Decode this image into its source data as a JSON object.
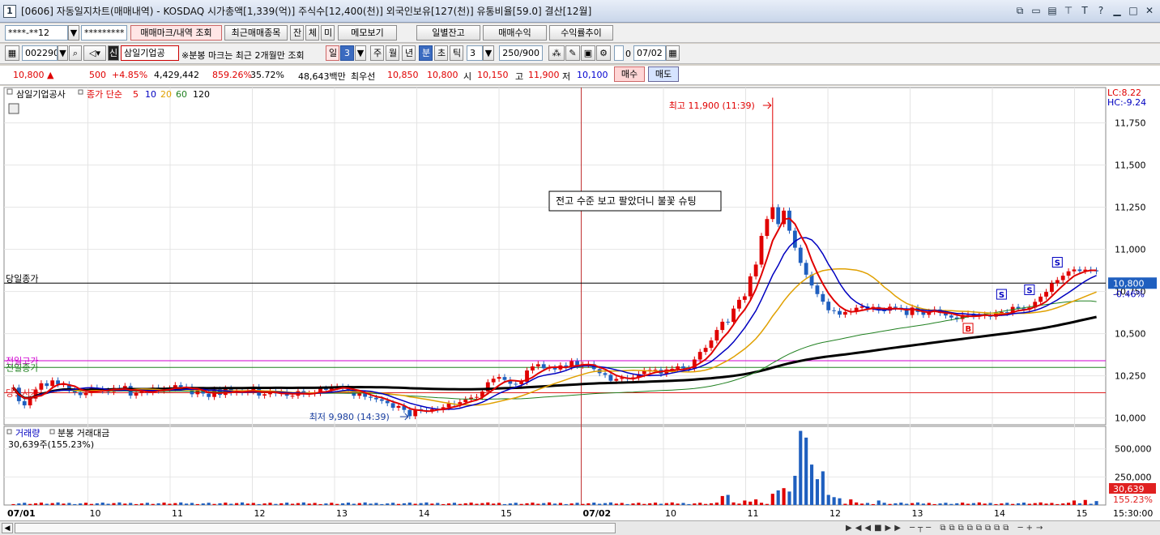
{
  "window": {
    "title": "[0606] 자동일지차트(매매내역) - KOSDAQ 시가총액[1,339(억)] 주식수[12,400(천)] 외국인보유[127(천)] 유통비율[59.0] 결산[12월]",
    "badge": "1"
  },
  "toolbar1": {
    "account": "****-**12",
    "password": "*********",
    "trade_mark_button": "매매마크/내역 조회",
    "recent_trades_button": "최근매매종목",
    "jan_button": "잔",
    "che_button": "체",
    "mi_button": "미",
    "memo_button": "메모보기",
    "daily_balance_button": "일별잔고",
    "trade_profit_button": "매매수익",
    "return_trend_button": "수익률추이"
  },
  "toolbar2": {
    "code": "002290",
    "badge": "신",
    "stock_name": "삼일기업공",
    "notice": "※분봉 마크는 최근 2개월만 조회",
    "period_day": "일",
    "period_num": "3",
    "week": "주",
    "month": "월",
    "year": "년",
    "minute": "분",
    "second": "초",
    "tick": "틱",
    "interval": "3",
    "count": "250/900",
    "date": "07/02",
    "checkbox_label": "0"
  },
  "quote": {
    "price": "10,800 ▲",
    "change": "500",
    "change_pct": "+4.85%",
    "volume": "4,429,442",
    "volume_pct": "859.26%",
    "turnover": "35.72%",
    "amount": "48,643백만",
    "pref_label": "최우선",
    "ask": "10,850",
    "bid": "10,800",
    "open_label": "시",
    "open": "10,150",
    "high_label": "고",
    "high": "11,900",
    "low_label": "저",
    "low": "10,100",
    "buy_button": "매수",
    "sell_button": "매도"
  },
  "colors": {
    "up": "#e00000",
    "down": "#1f5fbf",
    "ma5": "#e00000",
    "ma10": "#0000c0",
    "ma20": "#e0a000",
    "ma60": "#208020",
    "ma120": "#000000"
  },
  "chart_data": {
    "type": "line",
    "legend": {
      "stock": "삼일기업공사",
      "indicator": "종가 단순",
      "ma_labels": [
        "5",
        "10",
        "20",
        "60",
        "120"
      ]
    },
    "lc_label": "LC:8.22",
    "hc_label": "HC:-9.24",
    "y_ticks": [
      "11,750",
      "11,500",
      "11,250",
      "11,000",
      "10,750",
      "10,500",
      "10,250",
      "10,000"
    ],
    "ylim": [
      9960,
      11960
    ],
    "x_ticks": [
      "07/01",
      "10",
      "11",
      "12",
      "13",
      "14",
      "15",
      "07/02",
      "10",
      "11",
      "12",
      "13",
      "14",
      "15",
      "15:30:00"
    ],
    "hlines": [
      {
        "label": "당일종가",
        "value": 10800
      },
      {
        "label": "전일고가",
        "value": 10340
      },
      {
        "label": "전일종가",
        "value": 10300
      },
      {
        "label": "당일시가",
        "value": 10150
      }
    ],
    "current_price_label": "10,800",
    "current_change_label": "-0.46%",
    "annotation": "전고 수준 보고 팔았더니 불꽃 슈팅",
    "high_label": "최고 11,900 (11:39)",
    "low_label": "최저 9,980 (14:39)",
    "trade_marks": [
      {
        "type": "B",
        "index": 171
      },
      {
        "type": "S",
        "index": 177
      },
      {
        "type": "S",
        "index": 182
      },
      {
        "type": "S",
        "index": 187
      }
    ],
    "close_series": [
      10180,
      10100,
      10075,
      10115,
      10168,
      10206,
      10190,
      10223,
      10200,
      10200,
      10165,
      10153,
      10136,
      10148,
      10180,
      10172,
      10163,
      10155,
      10178,
      10177,
      10190,
      10133,
      10148,
      10157,
      10153,
      10180,
      10163,
      10172,
      10175,
      10195,
      10185,
      10184,
      10141,
      10164,
      10145,
      10125,
      10169,
      10137,
      10175,
      10151,
      10157,
      10152,
      10158,
      10183,
      10133,
      10141,
      10155,
      10146,
      10152,
      10132,
      10132,
      10160,
      10142,
      10145,
      10148,
      10174,
      10167,
      10183,
      10186,
      10183,
      10163,
      10132,
      10147,
      10126,
      10120,
      10111,
      10102,
      10088,
      10061,
      10071,
      10048,
      10011,
      10052,
      10046,
      10045,
      10052,
      10049,
      10064,
      10085,
      10081,
      10094,
      10110,
      10121,
      10125,
      10157,
      10212,
      10233,
      10243,
      10226,
      10203,
      10201,
      10214,
      10282,
      10306,
      10319,
      10295,
      10298,
      10288,
      10312,
      10303,
      10337,
      10310,
      10316,
      10319,
      10290,
      10266,
      10256,
      10221,
      10232,
      10238,
      10233,
      10241,
      10260,
      10281,
      10285,
      10286,
      10262,
      10288,
      10292,
      10306,
      10294,
      10292,
      10347,
      10392,
      10416,
      10460,
      10522,
      10571,
      10570,
      10649,
      10701,
      10722,
      10840,
      10910,
      11080,
      11180,
      11250,
      11150,
      11230,
      11111,
      11010,
      10920,
      10850,
      10786,
      10735,
      10690,
      10639,
      10635,
      10613,
      10629,
      10633,
      10654,
      10662,
      10647,
      10659,
      10638,
      10637,
      10660,
      10654,
      10647,
      10611,
      10655,
      10629,
      10612,
      10630,
      10644,
      10623,
      10608,
      10596,
      10587,
      10612,
      10619,
      10603,
      10606,
      10613,
      10601,
      10624,
      10628,
      10623,
      10659,
      10650,
      10643,
      10655,
      10689,
      10720,
      10748,
      10799,
      10818,
      10844,
      10870,
      10881,
      10872,
      10880,
      10876,
      10870
    ],
    "ma60_end": 10690,
    "ma120_end": 10600,
    "volume_ylim": [
      0,
      700000
    ],
    "volume_ticks": [
      "500,000",
      "250,000"
    ],
    "volume_label": "거래량",
    "amount_label": "분봉 거래대금",
    "volume_value": "30,639주(155.23%)",
    "volume_current": "30,639",
    "volume_pct": "155.23%",
    "volume_spikes": [
      {
        "index": 141,
        "value": 660000
      },
      {
        "index": 142,
        "value": 600000
      },
      {
        "index": 140,
        "value": 260000
      },
      {
        "index": 143,
        "value": 360000
      },
      {
        "index": 144,
        "value": 230000
      },
      {
        "index": 145,
        "value": 300000
      },
      {
        "index": 138,
        "value": 150000
      },
      {
        "index": 139,
        "value": 120000
      },
      {
        "index": 137,
        "value": 130000
      },
      {
        "index": 136,
        "value": 100000
      },
      {
        "index": 146,
        "value": 90000
      },
      {
        "index": 147,
        "value": 70000
      },
      {
        "index": 148,
        "value": 60000
      },
      {
        "index": 131,
        "value": 40000
      },
      {
        "index": 132,
        "value": 30000
      },
      {
        "index": 133,
        "value": 50000
      },
      {
        "index": 127,
        "value": 80000
      },
      {
        "index": 128,
        "value": 90000
      },
      {
        "index": 150,
        "value": 50000
      },
      {
        "index": 155,
        "value": 40000
      },
      {
        "index": 190,
        "value": 40000
      },
      {
        "index": 192,
        "value": 45000
      },
      {
        "index": 194,
        "value": 35000
      }
    ]
  }
}
